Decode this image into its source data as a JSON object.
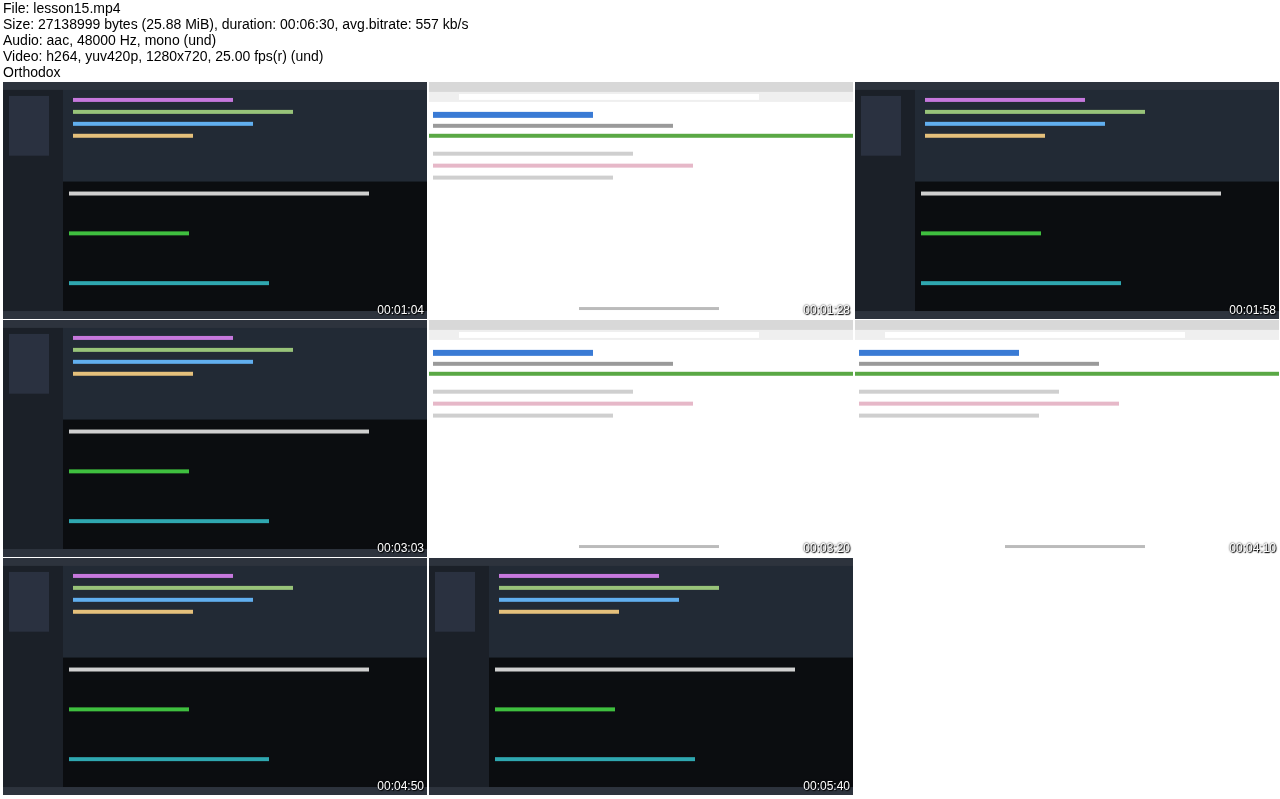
{
  "header": {
    "lines": [
      "File: lesson15.mp4",
      "Size: 27138999 bytes (25.88 MiB), duration: 00:06:30, avg.bitrate: 557 kb/s",
      "Audio: aac, 48000 Hz, mono (und)",
      "Video: h264, yuv420p, 1280x720, 25.00 fps(r) (und)",
      "Orthodox"
    ]
  },
  "frames": [
    {
      "kind": "picture",
      "timestamp": "00:01:04"
    },
    {
      "kind": "picture",
      "timestamp": "00:01:28"
    },
    {
      "kind": "picture",
      "timestamp": "00:01:58"
    },
    {
      "kind": "picture",
      "timestamp": "00:03:03"
    },
    {
      "kind": "picture",
      "timestamp": "00:03:20"
    },
    {
      "kind": "picture",
      "timestamp": "00:04:10"
    },
    {
      "kind": "picture",
      "timestamp": "00:04:50"
    },
    {
      "kind": "picture",
      "timestamp": "00:05:40"
    }
  ]
}
